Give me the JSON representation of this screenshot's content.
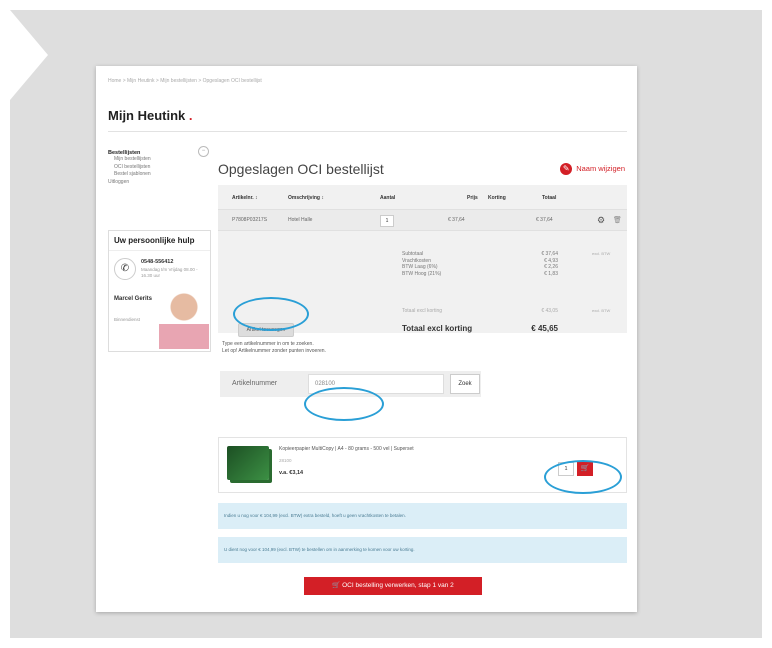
{
  "breadcrumb": "Home  >  Mijn Heutink  >  Mijn bestellijsten  >  Opgeslagen OCI bestellijst",
  "brand": {
    "name": "Mijn Heutink",
    "dot": "."
  },
  "sidebar": {
    "heading": "Bestellijsten",
    "items": [
      "Mijn bestellijsten",
      "OCI bestellijsten",
      "Bestel sjablonen"
    ],
    "logout": "Uitloggen",
    "toggle": "−"
  },
  "help": {
    "title": "Uw persoonlijke hulp",
    "phone": "0548-556412",
    "hours": "Maandag t/m Vrijdag 08.00 - 16.30 uur",
    "name": "Marcel Gerits",
    "role": "Binnendienst"
  },
  "list": {
    "title": "Opgeslagen OCI bestellijst",
    "rename": "Naam wijzigen",
    "headers": {
      "article": "Artikelnr. ↕",
      "desc": "Omschrijving ↕",
      "qty": "Aantal",
      "price": "Prijs",
      "discount": "Korting",
      "total": "Totaal"
    },
    "row": {
      "article": "P7808P03217S",
      "desc": "Hotel Halle",
      "qty": "1",
      "price": "€ 37,64",
      "total": "€ 37,64"
    },
    "summary_labels": "Subtotaal\nVrachtkosten\nBTW Laag (6%)\nBTW Hoog (21%)",
    "summary_values": "€ 37,64\n€ 4,93\n€ 2,26\n€ 1,83",
    "incl_btw": "excl. BTW",
    "discount_label": "Totaal excl korting",
    "discount_value": "€ 43,05",
    "total_label": "Totaal excl korting",
    "total_value": "€ 45,65",
    "add_button": "Artikel toevoegen"
  },
  "search": {
    "hint1": "Type een artikelnummer in om te zoeken.",
    "hint2": "Let op! Artikelnummer zonder punten invoeren.",
    "label": "Artikelnummer",
    "value": "028100",
    "button": "Zoek"
  },
  "product": {
    "name": "Kopieerpapier MultiCopy | A4 - 80 grams - 500 vel | Superset",
    "code": "28100",
    "price": "v.a. €3,14",
    "qty": "1",
    "cart_icon": "cart-icon"
  },
  "info1": "Indien u nog voor € 104,99 (excl. BTW) extra besteld, hoeft u geen vrachtkosten te betalen.",
  "info2": "U dient nog voor € 104,99 (excl. BTW) te bestellen om in aanmerking te komen voor uw korting.",
  "cta": "OCI bestelling verwerken, stap 1 van 2"
}
